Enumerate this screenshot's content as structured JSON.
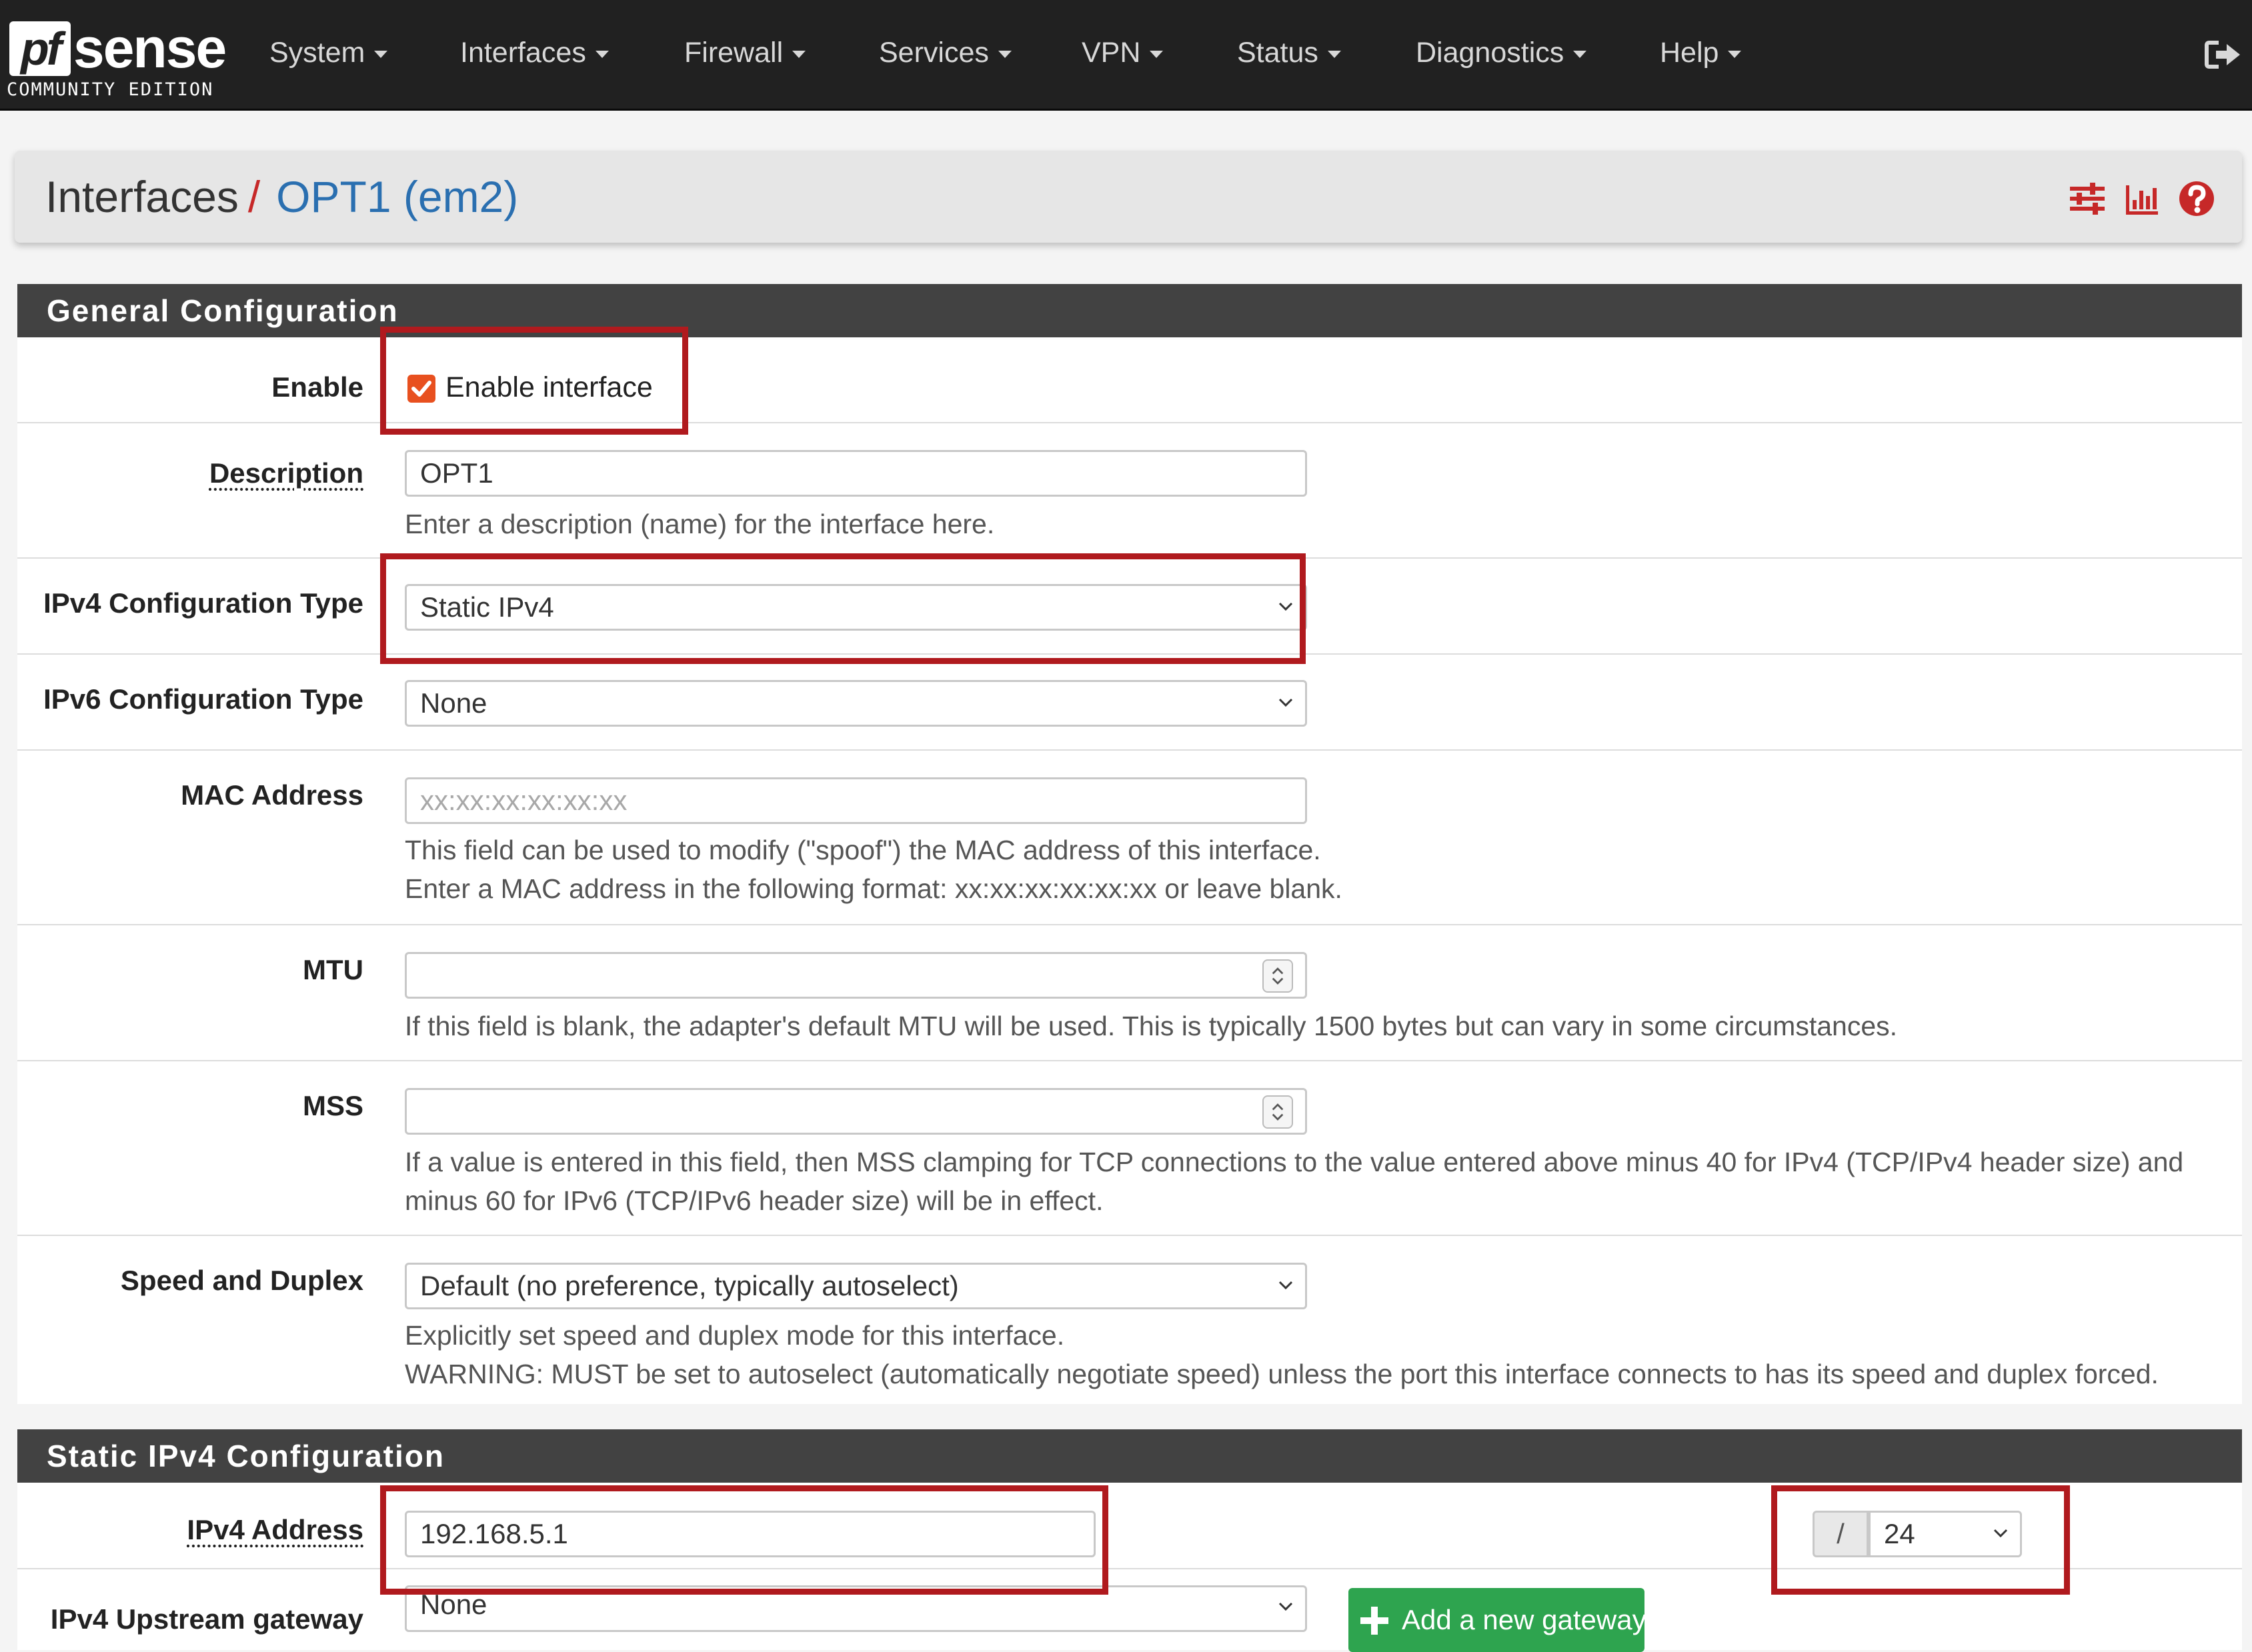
{
  "brand": {
    "logo_pf": "pf",
    "logo_sense": "sense",
    "edition": "COMMUNITY EDITION"
  },
  "nav": {
    "items": [
      "System",
      "Interfaces",
      "Firewall",
      "Services",
      "VPN",
      "Status",
      "Diagnostics",
      "Help"
    ],
    "logout_icon": "logout-icon"
  },
  "breadcrumb": {
    "parent": "Interfaces",
    "separator": "/",
    "current": "OPT1 (em2)",
    "icons": [
      "sliders-icon",
      "bar-chart-icon",
      "help-circle-icon"
    ]
  },
  "general": {
    "title": "General Configuration",
    "enable": {
      "label": "Enable",
      "checkbox_label": "Enable interface",
      "checked": true
    },
    "description": {
      "label": "Description",
      "value": "OPT1",
      "help": "Enter a description (name) for the interface here."
    },
    "ipv4_type": {
      "label": "IPv4 Configuration Type",
      "value": "Static IPv4"
    },
    "ipv6_type": {
      "label": "IPv6 Configuration Type",
      "value": "None"
    },
    "mac": {
      "label": "MAC Address",
      "placeholder": "xx:xx:xx:xx:xx:xx",
      "help1": "This field can be used to modify (\"spoof\") the MAC address of this interface.",
      "help2": "Enter a MAC address in the following format: xx:xx:xx:xx:xx:xx or leave blank."
    },
    "mtu": {
      "label": "MTU",
      "value": "",
      "help": "If this field is blank, the adapter's default MTU will be used. This is typically 1500 bytes but can vary in some circumstances."
    },
    "mss": {
      "label": "MSS",
      "value": "",
      "help1": "If a value is entered in this field, then MSS clamping for TCP connections to the value entered above minus 40 for IPv4 (TCP/IPv4 header size) and",
      "help2": "minus 60 for IPv6 (TCP/IPv6 header size) will be in effect."
    },
    "speed": {
      "label": "Speed and Duplex",
      "value": "Default (no preference, typically autoselect)",
      "help1": "Explicitly set speed and duplex mode for this interface.",
      "help2": "WARNING: MUST be set to autoselect (automatically negotiate speed) unless the port this interface connects to has its speed and duplex forced."
    }
  },
  "static_ipv4": {
    "title": "Static IPv4 Configuration",
    "address": {
      "label": "IPv4 Address",
      "value": "192.168.5.1",
      "prefix_sep": "/",
      "cidr": "24"
    },
    "gateway": {
      "label": "IPv4 Upstream gateway",
      "value": "None",
      "add_button": "Add a new gateway"
    }
  },
  "colors": {
    "accent_red": "#b01a1e",
    "checkbox": "#e8501f",
    "link_blue": "#2a6fb0",
    "button_green": "#2ea44f",
    "navbar": "#212121",
    "section_header": "#424242"
  }
}
